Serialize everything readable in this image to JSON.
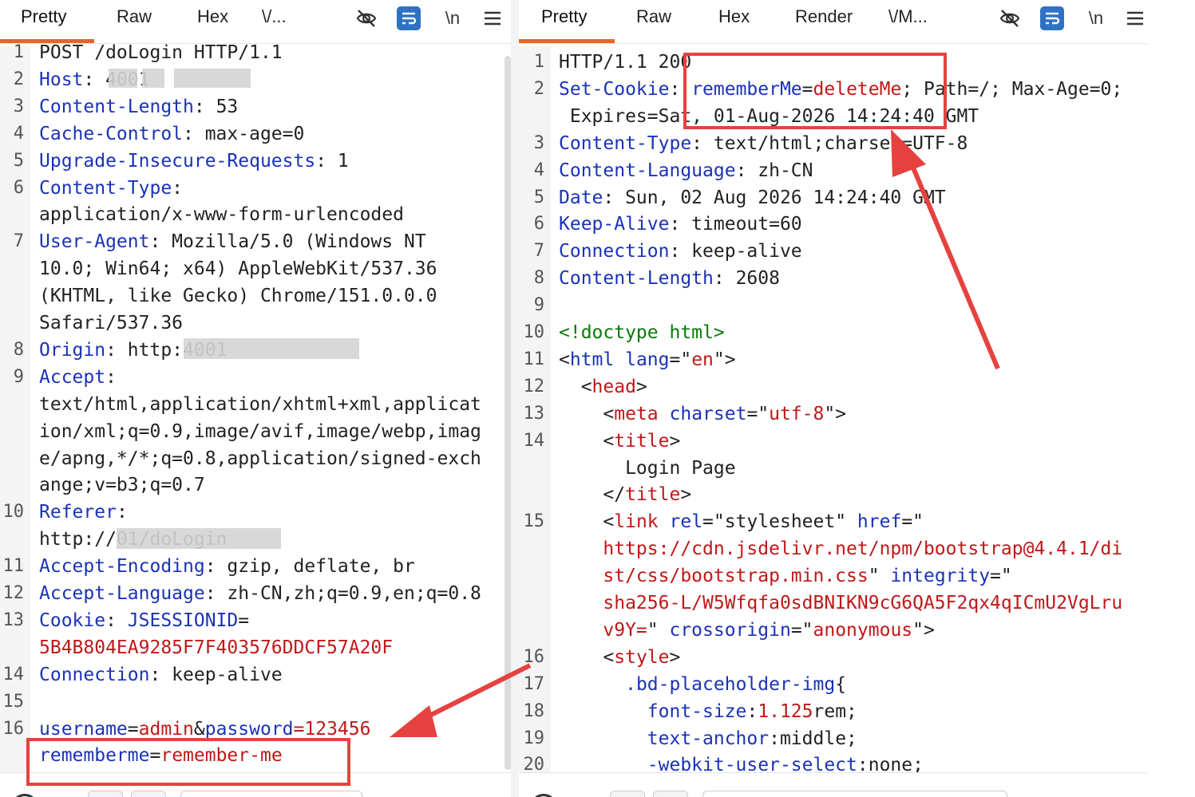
{
  "left": {
    "tabs": [
      {
        "label": "Pretty",
        "active": true
      },
      {
        "label": "Raw",
        "active": false
      },
      {
        "label": "Hex",
        "active": false
      },
      {
        "label": "\\/...",
        "active": false
      }
    ],
    "icons": [
      "hide-icon",
      "wrap-icon",
      "newline-icon",
      "menu-icon"
    ],
    "newline_label": "\\n",
    "lines": [
      {
        "n": "1",
        "segs": [
          {
            "t": "POST /doLogin HTTP/1.1",
            "c": "v"
          }
        ]
      },
      {
        "n": "2",
        "segs": [
          {
            "t": "Host",
            "c": "k"
          },
          {
            "t": ": ",
            "c": "v"
          },
          {
            "t": "4001",
            "c": "v"
          }
        ]
      },
      {
        "n": "3",
        "segs": [
          {
            "t": "Content-Length",
            "c": "k"
          },
          {
            "t": ": 53",
            "c": "v"
          }
        ]
      },
      {
        "n": "4",
        "segs": [
          {
            "t": "Cache-Control",
            "c": "k"
          },
          {
            "t": ": max-age=0",
            "c": "v"
          }
        ]
      },
      {
        "n": "5",
        "segs": [
          {
            "t": "Upgrade-Insecure-Requests",
            "c": "k"
          },
          {
            "t": ": 1",
            "c": "v"
          }
        ]
      },
      {
        "n": "6",
        "segs": [
          {
            "t": "Content-Type",
            "c": "k"
          },
          {
            "t": ":",
            "c": "v"
          }
        ]
      },
      {
        "n": "",
        "segs": [
          {
            "t": "application/x-www-form-urlencoded",
            "c": "v"
          }
        ]
      },
      {
        "n": "7",
        "segs": [
          {
            "t": "User-Agent",
            "c": "k"
          },
          {
            "t": ": Mozilla/5.0 (Windows NT",
            "c": "v"
          }
        ]
      },
      {
        "n": "",
        "segs": [
          {
            "t": "10.0; Win64; x64) AppleWebKit/537.36",
            "c": "v"
          }
        ]
      },
      {
        "n": "",
        "segs": [
          {
            "t": "(KHTML, like Gecko) Chrome/151.0.0.0",
            "c": "v"
          }
        ]
      },
      {
        "n": "",
        "segs": [
          {
            "t": "Safari/537.36",
            "c": "v"
          }
        ]
      },
      {
        "n": "8",
        "segs": [
          {
            "t": "Origin",
            "c": "k"
          },
          {
            "t": ": http:",
            "c": "v"
          },
          {
            "t": "4001",
            "c": "v"
          }
        ]
      },
      {
        "n": "9",
        "segs": [
          {
            "t": "Accept",
            "c": "k"
          },
          {
            "t": ":",
            "c": "v"
          }
        ]
      },
      {
        "n": "",
        "segs": [
          {
            "t": "text/html,application/xhtml+xml,applicat",
            "c": "v"
          }
        ]
      },
      {
        "n": "",
        "segs": [
          {
            "t": "ion/xml;q=0.9,image/avif,image/webp,imag",
            "c": "v"
          }
        ]
      },
      {
        "n": "",
        "segs": [
          {
            "t": "e/apng,*/*;q=0.8,application/signed-exch",
            "c": "v"
          }
        ]
      },
      {
        "n": "",
        "segs": [
          {
            "t": "ange;v=b3;q=0.7",
            "c": "v"
          }
        ]
      },
      {
        "n": "10",
        "segs": [
          {
            "t": "Referer",
            "c": "k"
          },
          {
            "t": ":",
            "c": "v"
          }
        ]
      },
      {
        "n": "",
        "segs": [
          {
            "t": "http://",
            "c": "v"
          },
          {
            "t": "01/doLogin",
            "c": "v"
          }
        ]
      },
      {
        "n": "11",
        "segs": [
          {
            "t": "Accept-Encoding",
            "c": "k"
          },
          {
            "t": ": gzip, deflate, br",
            "c": "v"
          }
        ]
      },
      {
        "n": "12",
        "segs": [
          {
            "t": "Accept-Language",
            "c": "k"
          },
          {
            "t": ": zh-CN,zh;q=0.9,en;q=0.8",
            "c": "v"
          }
        ]
      },
      {
        "n": "13",
        "segs": [
          {
            "t": "Cookie",
            "c": "k"
          },
          {
            "t": ": ",
            "c": "v"
          },
          {
            "t": "JSESSIONID",
            "c": "k"
          },
          {
            "t": "=",
            "c": "v"
          }
        ]
      },
      {
        "n": "",
        "segs": [
          {
            "t": "5B4B804EA9285F7F403576DDCF57A20F",
            "c": "r"
          }
        ]
      },
      {
        "n": "14",
        "segs": [
          {
            "t": "Connection",
            "c": "k"
          },
          {
            "t": ": keep-alive",
            "c": "v"
          }
        ]
      },
      {
        "n": "15",
        "segs": []
      },
      {
        "n": "16",
        "segs": [
          {
            "t": "username",
            "c": "k"
          },
          {
            "t": "=",
            "c": "v"
          },
          {
            "t": "admin",
            "c": "r"
          },
          {
            "t": "&",
            "c": "v"
          },
          {
            "t": "password",
            "c": "k"
          },
          {
            "t": "=123456",
            "c": "r"
          }
        ]
      },
      {
        "n": "",
        "segs": [
          {
            "t": "rememberme",
            "c": "k"
          },
          {
            "t": "=",
            "c": "v"
          },
          {
            "t": "remember-me",
            "c": "r"
          }
        ]
      }
    ]
  },
  "right": {
    "tabs": [
      {
        "label": "Pretty",
        "active": true
      },
      {
        "label": "Raw",
        "active": false
      },
      {
        "label": "Hex",
        "active": false
      },
      {
        "label": "Render",
        "active": false
      },
      {
        "label": "\\/M...",
        "active": false
      }
    ],
    "icons": [
      "hide-icon",
      "wrap-icon",
      "newline-icon",
      "menu-icon"
    ],
    "newline_label": "\\n",
    "lines": [
      {
        "n": "1",
        "segs": [
          {
            "t": "HTTP/1.1 200",
            "c": "v"
          }
        ]
      },
      {
        "n": "2",
        "segs": [
          {
            "t": "Set-Cookie",
            "c": "k"
          },
          {
            "t": ": ",
            "c": "v"
          },
          {
            "t": "rememberMe",
            "c": "k"
          },
          {
            "t": "=",
            "c": "v"
          },
          {
            "t": "deleteMe",
            "c": "r"
          },
          {
            "t": "; Path=/; Max-Age=0;",
            "c": "v"
          }
        ]
      },
      {
        "n": "",
        "segs": [
          {
            "t": " Expires=Sat, 01-Aug-2026 14:24:40 GMT",
            "c": "v"
          }
        ]
      },
      {
        "n": "3",
        "segs": [
          {
            "t": "Content-Type",
            "c": "k"
          },
          {
            "t": ": text/html;charset=UTF-8",
            "c": "v"
          }
        ]
      },
      {
        "n": "4",
        "segs": [
          {
            "t": "Content-Language",
            "c": "k"
          },
          {
            "t": ": zh-CN",
            "c": "v"
          }
        ]
      },
      {
        "n": "5",
        "segs": [
          {
            "t": "Date",
            "c": "k"
          },
          {
            "t": ": Sun, 02 Aug 2026 14:24:40 GMT",
            "c": "v"
          }
        ]
      },
      {
        "n": "6",
        "segs": [
          {
            "t": "Keep-Alive",
            "c": "k"
          },
          {
            "t": ": timeout=60",
            "c": "v"
          }
        ]
      },
      {
        "n": "7",
        "segs": [
          {
            "t": "Connection",
            "c": "k"
          },
          {
            "t": ": keep-alive",
            "c": "v"
          }
        ]
      },
      {
        "n": "8",
        "segs": [
          {
            "t": "Content-Length",
            "c": "k"
          },
          {
            "t": ": 2608",
            "c": "v"
          }
        ]
      },
      {
        "n": "9",
        "segs": []
      },
      {
        "n": "10",
        "segs": [
          {
            "t": "<!doctype html>",
            "c": "g"
          }
        ]
      },
      {
        "n": "11",
        "segs": [
          {
            "t": "<",
            "c": "v"
          },
          {
            "t": "html",
            "c": "k"
          },
          {
            "t": " ",
            "c": "v"
          },
          {
            "t": "lang",
            "c": "k"
          },
          {
            "t": "=\"",
            "c": "v"
          },
          {
            "t": "en",
            "c": "r"
          },
          {
            "t": "\">",
            "c": "v"
          }
        ]
      },
      {
        "n": "12",
        "segs": [
          {
            "t": "  <",
            "c": "v"
          },
          {
            "t": "head",
            "c": "r"
          },
          {
            "t": ">",
            "c": "v"
          }
        ]
      },
      {
        "n": "13",
        "segs": [
          {
            "t": "    <",
            "c": "v"
          },
          {
            "t": "meta",
            "c": "r"
          },
          {
            "t": " ",
            "c": "v"
          },
          {
            "t": "charset",
            "c": "k"
          },
          {
            "t": "=\"",
            "c": "v"
          },
          {
            "t": "utf-8",
            "c": "r"
          },
          {
            "t": "\">",
            "c": "v"
          }
        ]
      },
      {
        "n": "14",
        "segs": [
          {
            "t": "    <",
            "c": "v"
          },
          {
            "t": "title",
            "c": "r"
          },
          {
            "t": ">",
            "c": "v"
          }
        ]
      },
      {
        "n": "",
        "segs": [
          {
            "t": "      Login Page",
            "c": "v"
          }
        ]
      },
      {
        "n": "",
        "segs": [
          {
            "t": "    </",
            "c": "v"
          },
          {
            "t": "title",
            "c": "r"
          },
          {
            "t": ">",
            "c": "v"
          }
        ]
      },
      {
        "n": "15",
        "segs": [
          {
            "t": "    <",
            "c": "v"
          },
          {
            "t": "link",
            "c": "r"
          },
          {
            "t": " ",
            "c": "v"
          },
          {
            "t": "rel",
            "c": "k"
          },
          {
            "t": "=\"stylesheet\" ",
            "c": "v"
          },
          {
            "t": "href",
            "c": "k"
          },
          {
            "t": "=\"",
            "c": "v"
          }
        ]
      },
      {
        "n": "",
        "segs": [
          {
            "t": "    https://cdn.jsdelivr.net/npm/bootstrap@4.4.1/di",
            "c": "r"
          }
        ]
      },
      {
        "n": "",
        "segs": [
          {
            "t": "    st/css/bootstrap.min.css",
            "c": "r"
          },
          {
            "t": "\" ",
            "c": "v"
          },
          {
            "t": "integrity",
            "c": "k"
          },
          {
            "t": "=\"",
            "c": "v"
          }
        ]
      },
      {
        "n": "",
        "segs": [
          {
            "t": "    sha256-L/W5Wfqfa0sdBNIKN9cG6QA5F2qx4qICmU2VgLru",
            "c": "r"
          }
        ]
      },
      {
        "n": "",
        "segs": [
          {
            "t": "    v9Y=",
            "c": "r"
          },
          {
            "t": "\" ",
            "c": "v"
          },
          {
            "t": "crossorigin",
            "c": "k"
          },
          {
            "t": "=\"",
            "c": "v"
          },
          {
            "t": "anonymous",
            "c": "r"
          },
          {
            "t": "\">",
            "c": "v"
          }
        ]
      },
      {
        "n": "16",
        "segs": [
          {
            "t": "    <",
            "c": "v"
          },
          {
            "t": "style",
            "c": "r"
          },
          {
            "t": ">",
            "c": "v"
          }
        ]
      },
      {
        "n": "17",
        "segs": [
          {
            "t": "      ",
            "c": "v"
          },
          {
            "t": ".bd-placeholder-img",
            "c": "k"
          },
          {
            "t": "{",
            "c": "v"
          }
        ]
      },
      {
        "n": "18",
        "segs": [
          {
            "t": "        ",
            "c": "v"
          },
          {
            "t": "font-size",
            "c": "k"
          },
          {
            "t": ":",
            "c": "v"
          },
          {
            "t": "1.125",
            "c": "r"
          },
          {
            "t": "rem;",
            "c": "v"
          }
        ]
      },
      {
        "n": "19",
        "segs": [
          {
            "t": "        ",
            "c": "v"
          },
          {
            "t": "text-anchor",
            "c": "k"
          },
          {
            "t": ":middle;",
            "c": "v"
          }
        ]
      },
      {
        "n": "20",
        "segs": [
          {
            "t": "        ",
            "c": "v"
          },
          {
            "t": "-webkit-user-select",
            "c": "k"
          },
          {
            "t": ":none;",
            "c": "v"
          }
        ]
      }
    ]
  },
  "colors": {
    "key": "#1a32b8",
    "value": "#222222",
    "red": "#c01818",
    "green": "#0a7a0a",
    "accent": "#e8642a",
    "annotation": "#e5423f",
    "wrap_icon_bg": "#2f72c4"
  }
}
